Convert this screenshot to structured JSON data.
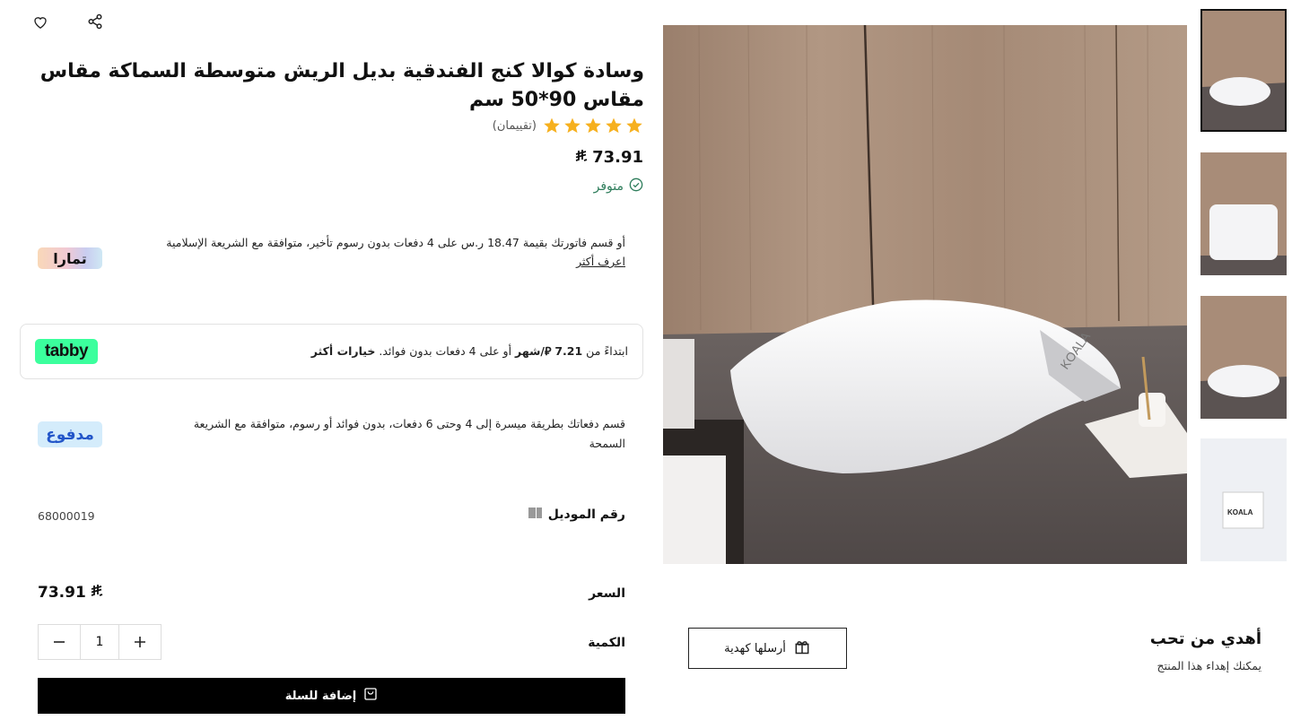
{
  "product": {
    "title": "وسادة كوالا كنج الفندقية بديل الريش متوسطة السماكة مقاس مقاس 90*50 سم",
    "rating_count": "(تقييمان)",
    "rating_value": 5,
    "rating_max": 5,
    "price": "73.91",
    "currency_symbol": "⃁",
    "stock_status": "متوفر"
  },
  "payments": {
    "tamara": {
      "logo": "تمارا",
      "text": "أو قسم فاتورتك بقيمة 18.47 ر.س على 4 دفعات بدون رسوم تأخير، متوافقة مع الشريعة الإسلامية",
      "learn_more": "اعرف أكثر"
    },
    "tabby": {
      "logo": "tabby",
      "text_prefix": "ابتداءً من ",
      "amount": "7.21",
      "per_month": "/شهر",
      "text_suffix": " أو على 4 دفعات بدون فوائد. ",
      "more": "خيارات أكثر"
    },
    "madfu": {
      "logo": "مدفوع",
      "text": "قسم دفعاتك بطريقة ميسرة إلى 4 وحتى 6 دفعات، بدون فوائد أو رسوم، متوافقة مع الشريعة السمحة"
    }
  },
  "details": {
    "model_label": "رقم الموديل",
    "model_value": "68000019",
    "price_label": "السعر",
    "price_value": "73.91",
    "quantity_label": "الكمية",
    "quantity_value": "1"
  },
  "actions": {
    "add_to_cart": "إضافة للسلة",
    "gift_button": "أرسلها كهدية"
  },
  "gift": {
    "title": "أهدي من تحب",
    "subtitle": "يمكنك إهداء هذا المنتج"
  },
  "icons": {
    "wishlist": "heart-icon",
    "share": "share-icon",
    "stock": "check-circle-icon",
    "barcode": "barcode-icon",
    "cart": "cart-icon",
    "gift": "gift-icon"
  },
  "colors": {
    "accent": "#000000",
    "star": "#f6b01e",
    "stock_green": "#2e7d5b",
    "tabby_green": "#3bff9d"
  }
}
